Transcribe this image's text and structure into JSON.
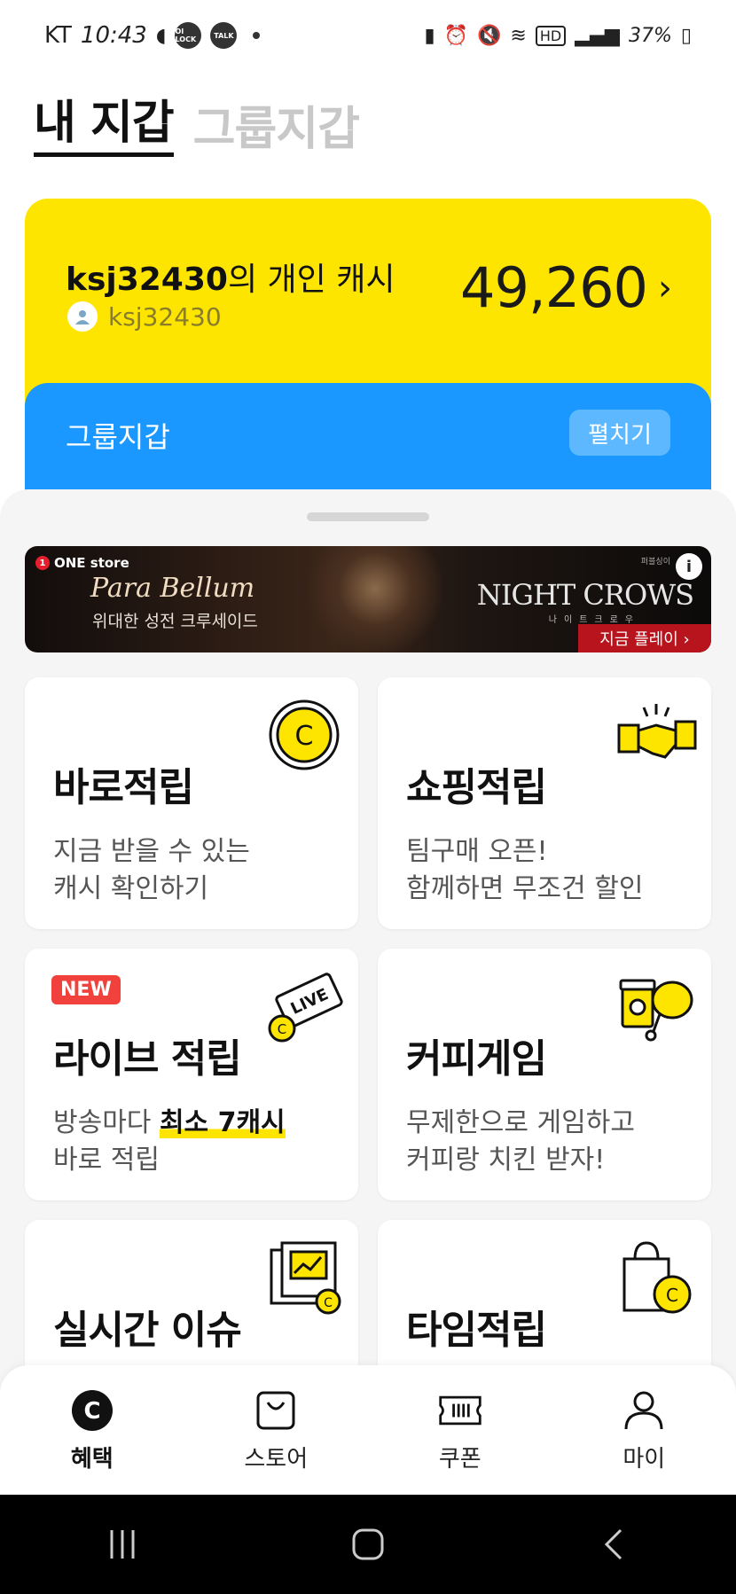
{
  "status_bar": {
    "carrier": "KT",
    "time": "10:43",
    "badges": [
      "OI LOCK",
      "TALK"
    ],
    "network": "HD",
    "battery": "37%"
  },
  "wallet_tabs": {
    "active": "내 지갑",
    "inactive": "그룹지갑"
  },
  "cash_card": {
    "owner": "ksj32430",
    "title_suffix": "의 개인 캐시",
    "username": "ksj32430",
    "amount": "49,260",
    "bg_color": "#fee500"
  },
  "group_card": {
    "label": "그룹지갑",
    "expand_label": "펼치기",
    "bg_color": "#1a98ff"
  },
  "banner": {
    "store_label": "ONE store",
    "title": "Para Bellum",
    "subtitle": "위대한 성전 크루세이드",
    "brand": "NIGHT CROWS",
    "brand_sub": "나이트크로우",
    "cta": "지금 플레이 ›",
    "tag": "퍼블싱이"
  },
  "cards": [
    {
      "title": "바로적립",
      "desc_line1": "지금 받을 수 있는",
      "desc_line2": "캐시 확인하기",
      "icon": "coin-icon"
    },
    {
      "title": "쇼핑적립",
      "desc_line1": "팀구매 오픈!",
      "desc_line2": "함께하면 무조건 할인",
      "icon": "handshake-icon"
    },
    {
      "title": "라이브 적립",
      "badge": "NEW",
      "desc_line1_pre": "방송마다 ",
      "desc_line1_hl": "최소 7캐시",
      "desc_line2": "바로 적립",
      "icon": "live-ticket-icon",
      "live_label": "LIVE"
    },
    {
      "title": "커피게임",
      "desc_line1": "무제한으로 게임하고",
      "desc_line2": "커피랑 치킨 받자!",
      "icon": "coffee-chicken-icon"
    },
    {
      "title": "실시간 이슈",
      "icon": "newspaper-chart-icon"
    },
    {
      "title": "타임적립",
      "icon": "shopping-bag-clock-icon"
    }
  ],
  "bottom_nav": [
    {
      "label": "혜택",
      "icon": "cash-coin-icon",
      "active": true
    },
    {
      "label": "스토어",
      "icon": "bag-icon",
      "active": false
    },
    {
      "label": "쿠폰",
      "icon": "ticket-icon",
      "active": false
    },
    {
      "label": "마이",
      "icon": "person-icon",
      "active": false
    }
  ]
}
